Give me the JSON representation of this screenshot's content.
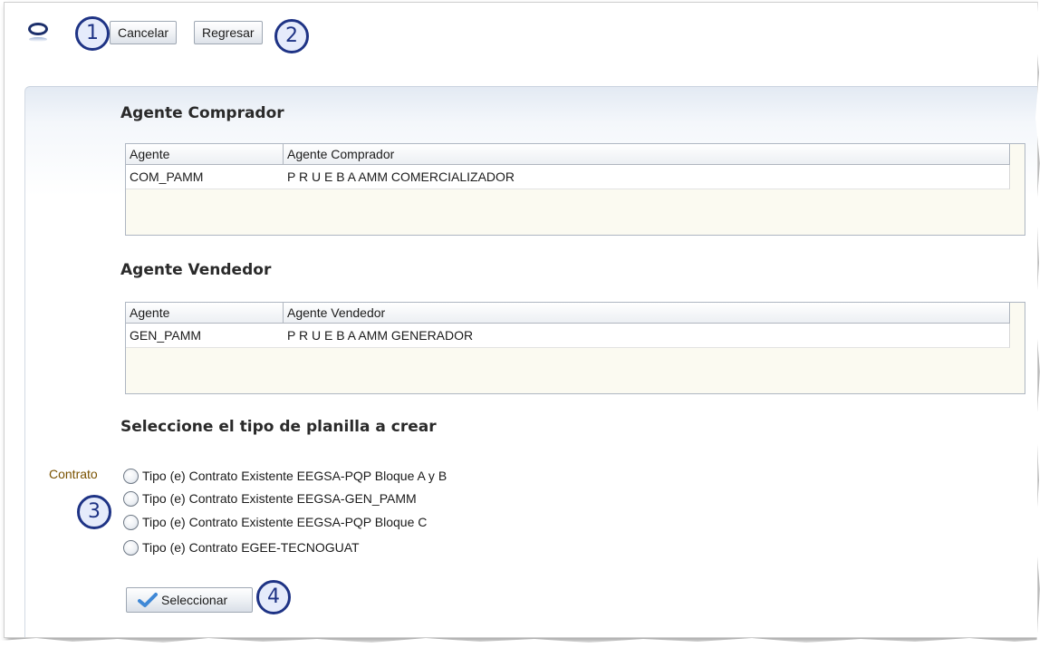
{
  "toolbar": {
    "cancel_label": "Cancelar",
    "back_label": "Regresar"
  },
  "callouts": [
    "1",
    "2",
    "3",
    "4"
  ],
  "buyer": {
    "title": "Agente Comprador",
    "columns": [
      "Agente",
      "Agente Comprador"
    ],
    "rows": [
      {
        "agent": "COM_PAMM",
        "name": "P R U E B A AMM COMERCIALIZADOR"
      }
    ]
  },
  "seller": {
    "title": "Agente Vendedor",
    "columns": [
      "Agente",
      "Agente Vendedor"
    ],
    "rows": [
      {
        "agent": "GEN_PAMM",
        "name": "P R U E B A AMM GENERADOR"
      }
    ]
  },
  "template_type": {
    "title": "Seleccione el tipo de planilla a crear",
    "group_label": "Contrato",
    "options": [
      "Tipo (e) Contrato Existente EEGSA-PQP Bloque A y B",
      "Tipo (e) Contrato Existente EEGSA-GEN_PAMM",
      "Tipo (e) Contrato Existente EEGSA-PQP Bloque C",
      "Tipo (e) Contrato EGEE-TECNOGUAT"
    ],
    "select_label": "Seleccionar"
  },
  "colors": {
    "callout": "#1e3385",
    "logo": "#1c2f6b",
    "check": "#3f88d6"
  }
}
